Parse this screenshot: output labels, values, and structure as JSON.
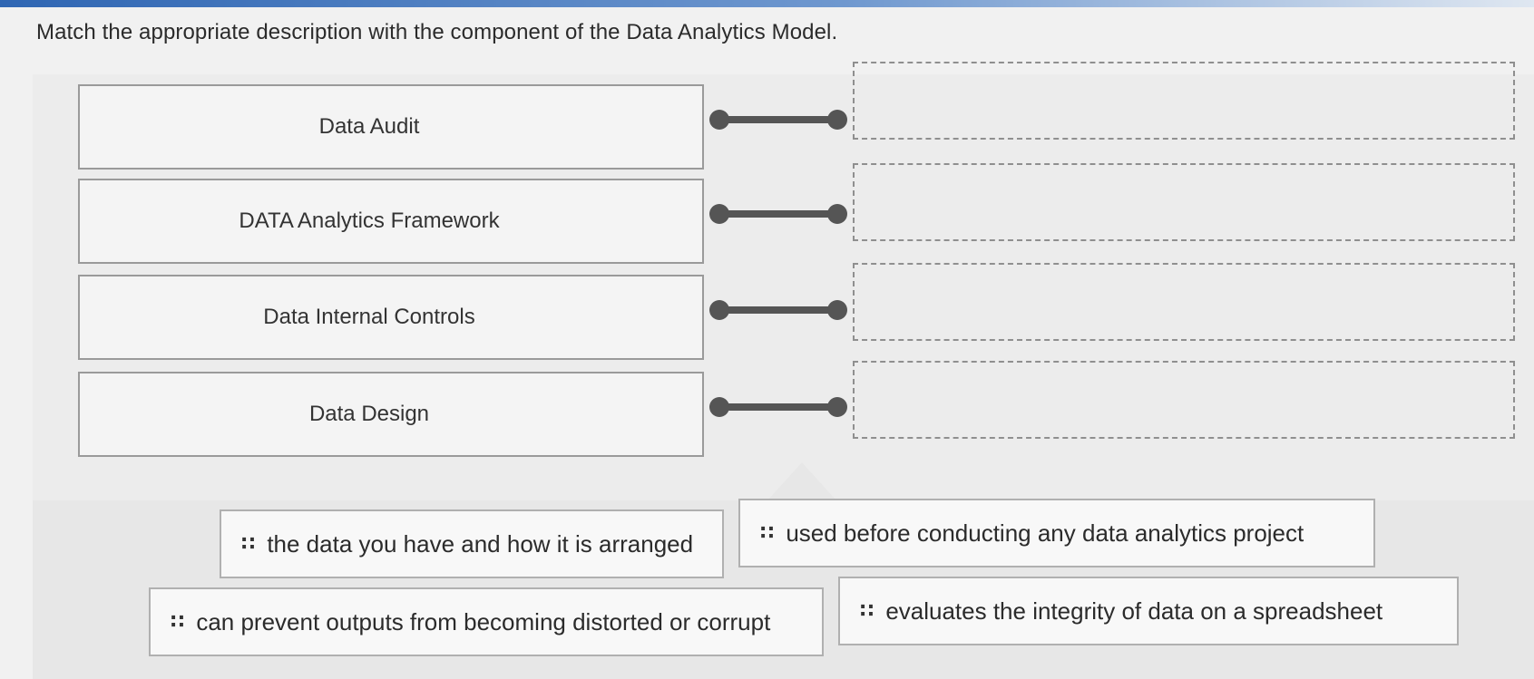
{
  "instructions": "Match the appropriate description with the component of the Data Analytics Model.",
  "terms": [
    {
      "label": "Data Audit"
    },
    {
      "label": "DATA Analytics Framework"
    },
    {
      "label": "Data Internal Controls"
    },
    {
      "label": "Data Design"
    }
  ],
  "answers": [
    {
      "label": "the data you have and how it is arranged"
    },
    {
      "label": "used before conducting any data analytics project"
    },
    {
      "label": "can prevent outputs from becoming distorted or corrupt"
    },
    {
      "label": "evaluates the integrity of data on a spreadsheet"
    }
  ],
  "icons": {
    "grip": "drag-handle-icon"
  },
  "colors": {
    "connector": "#555555",
    "drop_border": "#8f8f8f",
    "header_band": "#2f66b3"
  }
}
